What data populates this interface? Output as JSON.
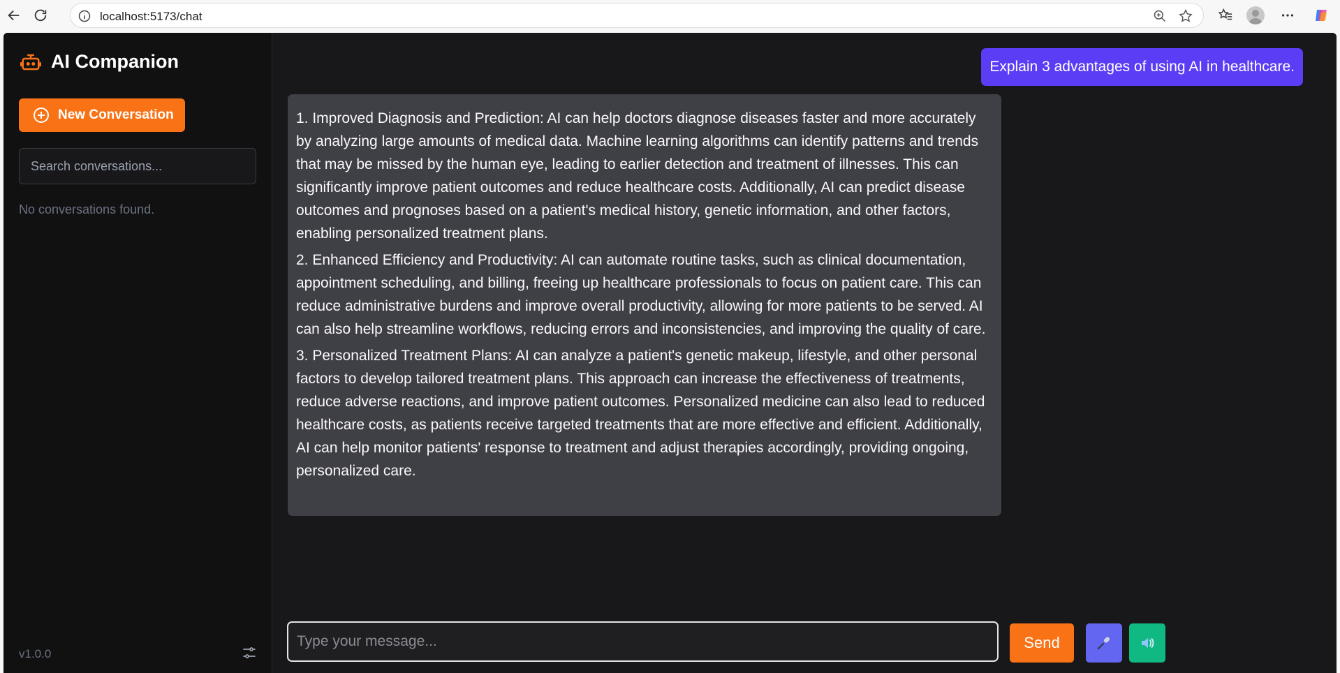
{
  "browser": {
    "url": "localhost:5173/chat"
  },
  "sidebar": {
    "brand_title": "AI Companion",
    "new_conversation_label": "New Conversation",
    "search_placeholder": "Search conversations...",
    "empty_text": "No conversations found.",
    "version": "v1.0.0"
  },
  "chat": {
    "user_message": "Explain 3 advantages of using AI in healthcare.",
    "assistant_paragraphs": [
      "1. Improved Diagnosis and Prediction: AI can help doctors diagnose diseases faster and more accurately by analyzing large amounts of medical data. Machine learning algorithms can identify patterns and trends that may be missed by the human eye, leading to earlier detection and treatment of illnesses. This can significantly improve patient outcomes and reduce healthcare costs. Additionally, AI can predict disease outcomes and prognoses based on a patient's medical history, genetic information, and other factors, enabling personalized treatment plans.",
      "2. Enhanced Efficiency and Productivity: AI can automate routine tasks, such as clinical documentation, appointment scheduling, and billing, freeing up healthcare professionals to focus on patient care. This can reduce administrative burdens and improve overall productivity, allowing for more patients to be served. AI can also help streamline workflows, reducing errors and inconsistencies, and improving the quality of care.",
      "3. Personalized Treatment Plans: AI can analyze a patient's genetic makeup, lifestyle, and other personal factors to develop tailored treatment plans. This approach can increase the effectiveness of treatments, reduce adverse reactions, and improve patient outcomes. Personalized medicine can also lead to reduced healthcare costs, as patients receive targeted treatments that are more effective and efficient. Additionally, AI can help monitor patients' response to treatment and adjust therapies accordingly, providing ongoing, personalized care."
    ],
    "input_placeholder": "Type your message...",
    "send_label": "Send"
  },
  "icons": {
    "brand": "robot-icon",
    "new_conversation": "plus-circle-icon",
    "settings": "sliders-icon",
    "mic": "microphone-icon",
    "speaker": "speaker-icon"
  },
  "colors": {
    "accent": "#f97316",
    "user_bubble": "#5b3df6",
    "assistant_bubble": "#3f3f46",
    "mic_button": "#6366f1",
    "speaker_button": "#10b981",
    "background": "#18181b",
    "sidebar": "#111112"
  }
}
